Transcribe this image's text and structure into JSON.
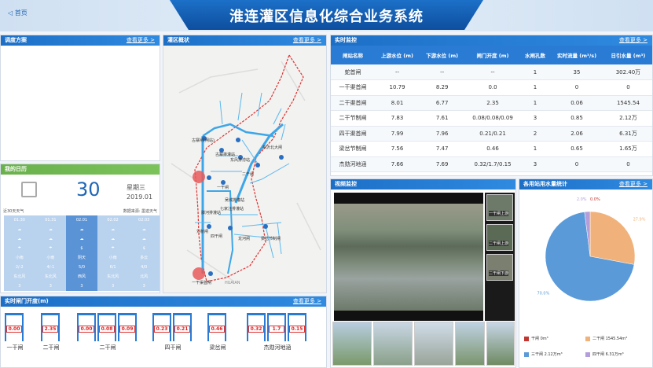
{
  "header": {
    "back_label": "首页",
    "title": "淮连灌区信息化综合业务系统"
  },
  "panels": {
    "plan": {
      "title": "调度方案",
      "more": "查看更多 >"
    },
    "map": {
      "title": "灌区概状",
      "more": "查看更多 >"
    },
    "realtime": {
      "title": "实时监控",
      "more": "查看更多 >"
    },
    "calendar": {
      "title": "我的日历"
    },
    "gates": {
      "title": "实时闸门开度(m)",
      "more": "查看更多 >"
    },
    "video": {
      "title": "视频监控"
    },
    "stats": {
      "title": "各用站用水量统计",
      "more": "查看更多 >"
    }
  },
  "table": {
    "headers": [
      "闸站名称",
      "上游水位 (m)",
      "下游水位 (m)",
      "闸门开度 (m)",
      "水闸孔数",
      "实时流量 (m³/s)",
      "日引水量 (m³)"
    ],
    "rows": [
      [
        "蛇首闸",
        "--",
        "--",
        "--",
        "1",
        "35",
        "302.40万"
      ],
      [
        "一干渠首闸",
        "10.79",
        "8.29",
        "0.0",
        "1",
        "0",
        "0"
      ],
      [
        "二干渠首闸",
        "8.01",
        "6.77",
        "2.35",
        "1",
        "0.06",
        "1545.54"
      ],
      [
        "二干节制闸",
        "7.83",
        "7.61",
        "0.08/0.08/0.09",
        "3",
        "0.85",
        "2.12万"
      ],
      [
        "四干渠首闸",
        "7.99",
        "7.96",
        "0.21/0.21",
        "2",
        "2.06",
        "6.31万"
      ],
      [
        "梁岔节制闸",
        "7.56",
        "7.47",
        "0.46",
        "1",
        "0.65",
        "1.65万"
      ],
      [
        "杰勋河地涵",
        "7.66",
        "7.69",
        "0.32/1.7/0.15",
        "3",
        "0",
        "0"
      ]
    ]
  },
  "calendar": {
    "day": "30",
    "weekday": "星期三",
    "month": "2019.01",
    "left_note": "近30天天气",
    "right_note": "数据来源: 墨迹天气",
    "days": [
      {
        "date": "01.30",
        "t": "2/-2",
        "w": "东北风",
        "lv": "3"
      },
      {
        "date": "01.31",
        "t": "4/-1",
        "w": "东北风",
        "lv": "3"
      },
      {
        "date": "02.01",
        "t": "5/0",
        "w": "西风",
        "lv": "3"
      },
      {
        "date": "02.02",
        "t": "6/1",
        "w": "东北风",
        "lv": "3"
      },
      {
        "date": "02.03",
        "t": "4/0",
        "w": "北风",
        "lv": "3"
      }
    ]
  },
  "map": {
    "labels": [
      "古寨闸(闸站)",
      "古寨排灌站",
      "东风排涝站",
      "一干闸",
      "新沂北大闸",
      "二干闸",
      "吴城排灌站",
      "七家汪排灌站",
      "滕河排灌站",
      "刘桥闸",
      "四干闸",
      "龙河闸",
      "梁岔节制闸",
      "HUAIAN",
      "一干渠首闸"
    ]
  },
  "gates": [
    {
      "name": "一干闸",
      "values": [
        "0.00"
      ]
    },
    {
      "name": "二干闸",
      "values": [
        "2.35"
      ]
    },
    {
      "name": "二干闸",
      "values": [
        "0.00",
        "0.08",
        "0.09"
      ]
    },
    {
      "name": "四干闸",
      "values": [
        "0.23",
        "0.21"
      ]
    },
    {
      "name": "梁岔闸",
      "values": [
        "0.46"
      ]
    },
    {
      "name": "杰勋河地涵",
      "values": [
        "0.32",
        "1.7",
        "0.15"
      ]
    }
  ],
  "video": {
    "side": [
      "一干闸上游",
      "二干闸上游",
      "二干闸下游"
    ]
  },
  "chart_data": {
    "type": "pie",
    "slices": [
      {
        "name": "干闸 0m³",
        "value": 0.0,
        "label": "0.0%",
        "color": "#c23531"
      },
      {
        "name": "二干闸 1545.54m³",
        "value": 27.9,
        "label": "27.9%",
        "color": "#f0b27a"
      },
      {
        "name": "三干闸 2.12万m³",
        "value": 70.0,
        "label": "70.0%",
        "color": "#5a9ad8"
      },
      {
        "name": "四干闸 6.31万m³",
        "value": 2.0,
        "label": "2.0%",
        "color": "#b39ddb"
      }
    ]
  }
}
